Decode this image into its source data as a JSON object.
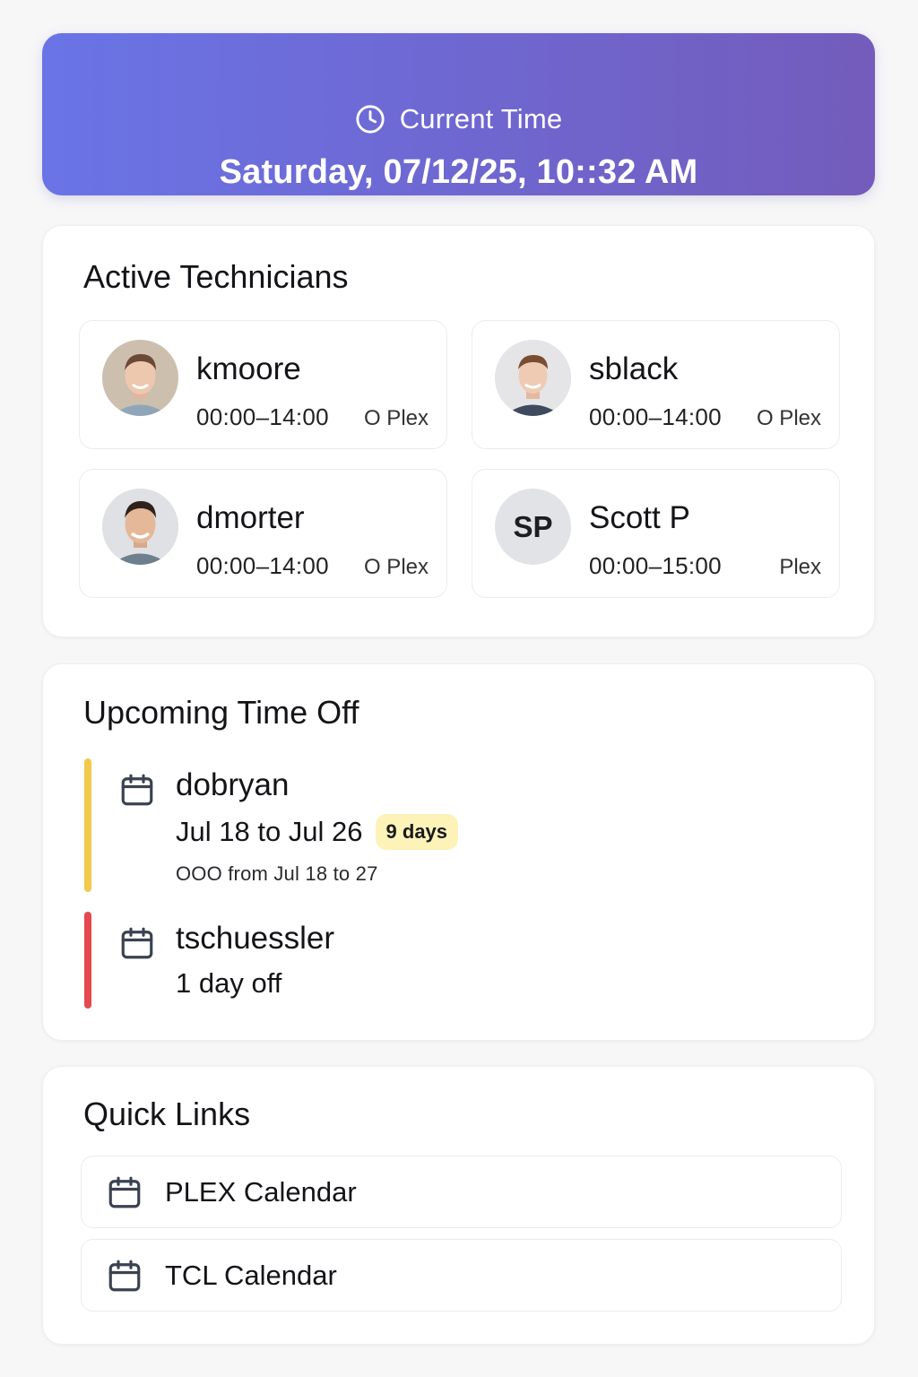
{
  "current_time": {
    "icon": "clock-icon",
    "label": "Current Time",
    "value": "Saturday, 07/12/25, 10::32 AM",
    "gradient": [
      "#6a74e6",
      "#735cbb"
    ]
  },
  "active_technicians": {
    "title": "Active Technicians",
    "items": [
      {
        "name": "kmoore",
        "hours": "00:00–14:00",
        "badge": "O Plex",
        "avatar": "photo"
      },
      {
        "name": "sblack",
        "hours": "00:00–14:00",
        "badge": "O Plex",
        "avatar": "photo"
      },
      {
        "name": "dmorter",
        "hours": "00:00–14:00",
        "badge": "O Plex",
        "avatar": "photo"
      },
      {
        "name": "Scott P",
        "hours": "00:00–15:00",
        "badge": "Plex",
        "avatar": "initials",
        "initials": "SP"
      }
    ]
  },
  "upcoming_time_off": {
    "title": "Upcoming Time Off",
    "items": [
      {
        "name": "dobryan",
        "range": "Jul 18 to Jul 26",
        "pill": "9 days",
        "note": "OOO from Jul 18 to 27",
        "accent": "#f2c94c",
        "icon": "calendar-icon"
      },
      {
        "name": "tschuessler",
        "range": "1 day off",
        "accent": "#e5484d",
        "icon": "calendar-icon"
      }
    ]
  },
  "quick_links": {
    "title": "Quick Links",
    "items": [
      {
        "label": "PLEX Calendar",
        "icon": "calendar-icon"
      },
      {
        "label": "TCL Calendar",
        "icon": "calendar-icon"
      }
    ]
  }
}
